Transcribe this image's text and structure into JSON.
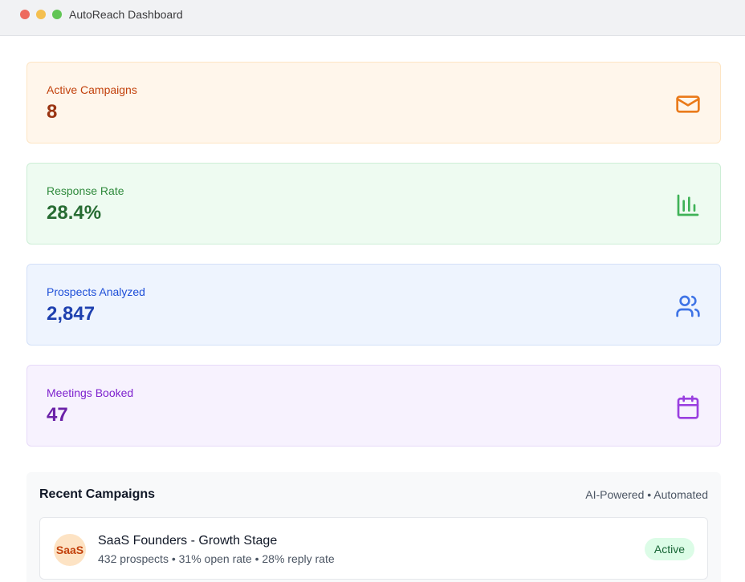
{
  "window": {
    "title": "AutoReach Dashboard"
  },
  "stats": [
    {
      "label": "Active Campaigns",
      "value": "8",
      "icon": "mail-icon",
      "color": "#ea7a1a"
    },
    {
      "label": "Response Rate",
      "value": "28.4%",
      "icon": "bar-chart-icon",
      "color": "#3fb257"
    },
    {
      "label": "Prospects Analyzed",
      "value": "2,847",
      "icon": "users-icon",
      "color": "#3f74e6"
    },
    {
      "label": "Meetings Booked",
      "value": "47",
      "icon": "calendar-icon",
      "color": "#9a3fe0"
    }
  ],
  "recent": {
    "title": "Recent Campaigns",
    "meta": "AI-Powered • Automated",
    "campaigns": [
      {
        "avatar": "SaaS",
        "name": "SaaS Founders - Growth Stage",
        "stats": "432 prospects • 31% open rate • 28% reply rate",
        "status": "Active"
      }
    ]
  }
}
